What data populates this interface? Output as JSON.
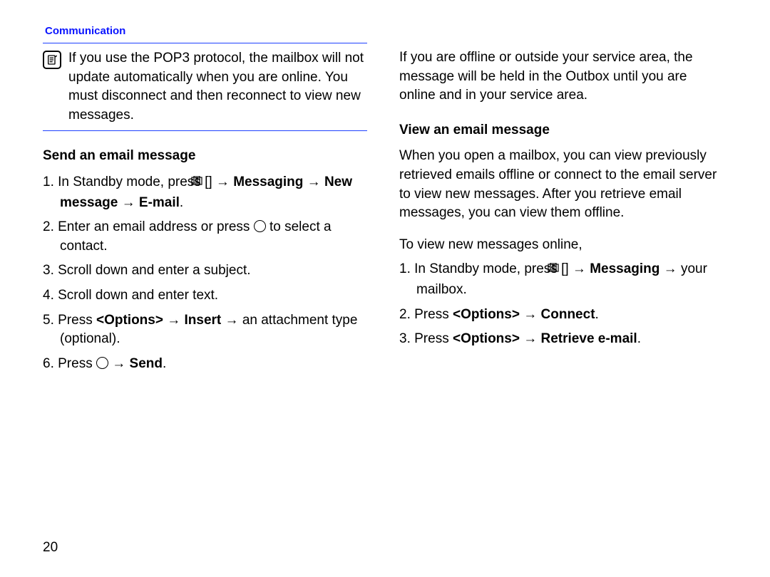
{
  "header": "Communication",
  "page_number": "20",
  "left": {
    "note": "If you use the POP3 protocol, the mailbox will not update automatically when you are online. You must disconnect and then reconnect to view new messages.",
    "section": "Send an email message",
    "steps": {
      "s1a": "1. In Standby mode, press [",
      "s1b": "] → ",
      "s1bold": "Messaging → New message → E-mail",
      "s1c": ".",
      "s2a": "2. Enter an email address or press ",
      "s2b": " to select a contact.",
      "s3": "3. Scroll down and enter a subject.",
      "s4": "4. Scroll down and enter text.",
      "s5a": "5. Press ",
      "s5b": "<Options>",
      "s5c": " → ",
      "s5d": "Insert",
      "s5e": " → an attachment type (optional).",
      "s6a": "6. Press ",
      "s6b": " → ",
      "s6c": "Send",
      "s6d": "."
    }
  },
  "right": {
    "intro": "If you are offline or outside your service area, the message will be held in the Outbox until you are online and in your service area.",
    "section": "View an email message",
    "para1": "When you open a mailbox, you can view previously retrieved emails offline or connect to the email server to view new messages. After you retrieve email messages, you can view them offline.",
    "para2": "To view new messages online,",
    "steps": {
      "s1a": "1. In Standby mode, press [",
      "s1b": "] → ",
      "s1bold": "Messaging",
      "s1c": " → your mailbox.",
      "s2a": "2. Press ",
      "s2b": "<Options>",
      "s2c": " → ",
      "s2d": "Connect",
      "s2e": ".",
      "s3a": "3. Press ",
      "s3b": "<Options>",
      "s3c": " → ",
      "s3d": "Retrieve e-mail",
      "s3e": "."
    }
  }
}
